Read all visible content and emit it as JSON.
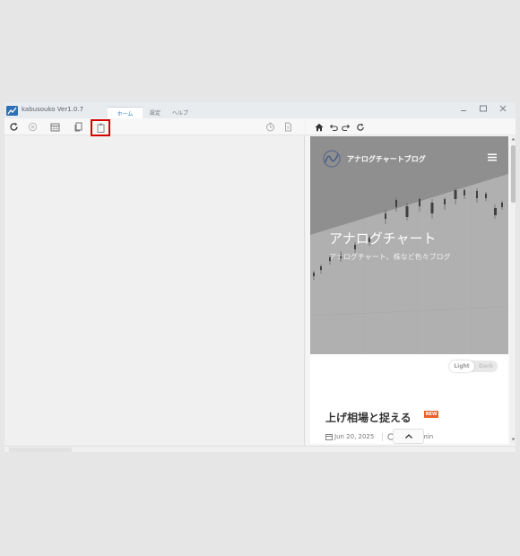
{
  "app": {
    "title": "kabusouko Ver1.0.7",
    "accent": "#3a84c8"
  },
  "menu": {
    "tabs": [
      "ホーム",
      "設定",
      "ヘルプ"
    ],
    "active": 0
  },
  "window_controls": {
    "minimize": "minimize-icon",
    "maximize": "maximize-icon",
    "close": "close-icon"
  },
  "left_toolbar": [
    "refresh-icon",
    "cancel-icon",
    "calendar-icon",
    "copy-icon",
    "paste-icon",
    "timer-icon",
    "document-icon"
  ],
  "right_toolbar": [
    "home-icon",
    "back-icon",
    "forward-icon",
    "reload-icon"
  ],
  "web": {
    "site_name": "アナログチャートブログ",
    "hero_title": "アナログチャート",
    "hero_subtitle": "アナログチャート、株など色々ブログ",
    "theme_light": "Light",
    "theme_dark": "Dark",
    "post_title": "上げ相場と捉える",
    "post_badge": "NEW",
    "post_date": "Jun 20, 2025",
    "post_author": "min"
  }
}
